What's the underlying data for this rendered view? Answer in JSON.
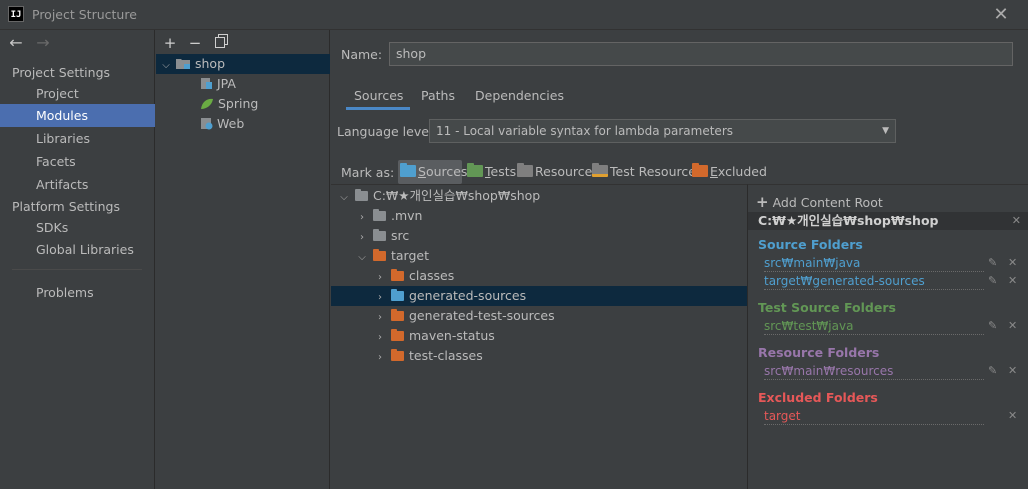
{
  "window": {
    "title": "Project Structure"
  },
  "nav": {
    "back_icon": "arrow-left-icon",
    "forward_icon": "arrow-right-icon",
    "project_settings_label": "Project Settings",
    "project_settings_items": [
      "Project",
      "Modules",
      "Libraries",
      "Facets",
      "Artifacts"
    ],
    "platform_settings_label": "Platform Settings",
    "platform_settings_items": [
      "SDKs",
      "Global Libraries"
    ],
    "problems_label": "Problems",
    "selected": "Modules"
  },
  "modules": {
    "toolbar": {
      "add": "+",
      "remove": "−",
      "copy": "copy-icon"
    },
    "tree": [
      {
        "label": "shop",
        "level": 0,
        "icon": "module-folder-icon",
        "expanded": true,
        "selected": true
      },
      {
        "label": "JPA",
        "level": 1,
        "icon": "jpa-icon"
      },
      {
        "label": "Spring",
        "level": 1,
        "icon": "spring-leaf-icon"
      },
      {
        "label": "Web",
        "level": 1,
        "icon": "web-icon"
      }
    ]
  },
  "main": {
    "name_label": "Name:",
    "name_value": "shop",
    "tabs": [
      "Sources",
      "Paths",
      "Dependencies"
    ],
    "active_tab": "Sources",
    "language_level_label": "Language level:",
    "language_level_value": "11 - Local variable syntax for lambda parameters",
    "mark_as_label": "Mark as:",
    "mark_as": [
      {
        "label": "Sources",
        "u": "S",
        "rest": "ources",
        "color": "#4f9fcf",
        "active": true
      },
      {
        "label": "Tests",
        "u": "T",
        "rest": "ests",
        "color": "#629755"
      },
      {
        "label": "Resources",
        "u": "",
        "rest": "Resources",
        "color": "#7f7f7f"
      },
      {
        "label": "Test Resources",
        "u": "",
        "rest": "Test Resources",
        "color": "#7f7f7f"
      },
      {
        "label": "Excluded",
        "u": "E",
        "rest": "xcluded",
        "color": "#d2692c"
      }
    ]
  },
  "tree": [
    {
      "label": "C:₩★개인실습₩shop₩shop",
      "level": 0,
      "chev": "down",
      "folder": "#8a8e91"
    },
    {
      "label": ".mvn",
      "level": 1,
      "chev": "right",
      "folder": "#8a8e91"
    },
    {
      "label": "src",
      "level": 1,
      "chev": "right",
      "folder": "#8a8e91"
    },
    {
      "label": "target",
      "level": 1,
      "chev": "down",
      "folder": "#d2692c"
    },
    {
      "label": "classes",
      "level": 2,
      "chev": "right",
      "folder": "#d2692c"
    },
    {
      "label": "generated-sources",
      "level": 2,
      "chev": "right",
      "folder": "#4f9fcf",
      "selected": true
    },
    {
      "label": "generated-test-sources",
      "level": 2,
      "chev": "right",
      "folder": "#d2692c"
    },
    {
      "label": "maven-status",
      "level": 2,
      "chev": "right",
      "folder": "#d2692c"
    },
    {
      "label": "test-classes",
      "level": 2,
      "chev": "right",
      "folder": "#d2692c"
    }
  ],
  "content_root": {
    "add_label": "Add Content Root",
    "add_u": "C",
    "path": "C:₩★개인실습₩shop₩shop",
    "sections": [
      {
        "title": "Source Folders",
        "color": "#4f9fcf",
        "paths": [
          "src₩main₩java",
          "target₩generated-sources"
        ],
        "editable": true
      },
      {
        "title": "Test Source Folders",
        "color": "#629755",
        "paths": [
          "src₩test₩java"
        ],
        "editable": true
      },
      {
        "title": "Resource Folders",
        "color": "#9876aa",
        "paths": [
          "src₩main₩resources"
        ],
        "editable": true
      },
      {
        "title": "Excluded Folders",
        "color": "#e65858",
        "paths": [
          "target"
        ],
        "editable": false
      }
    ]
  }
}
